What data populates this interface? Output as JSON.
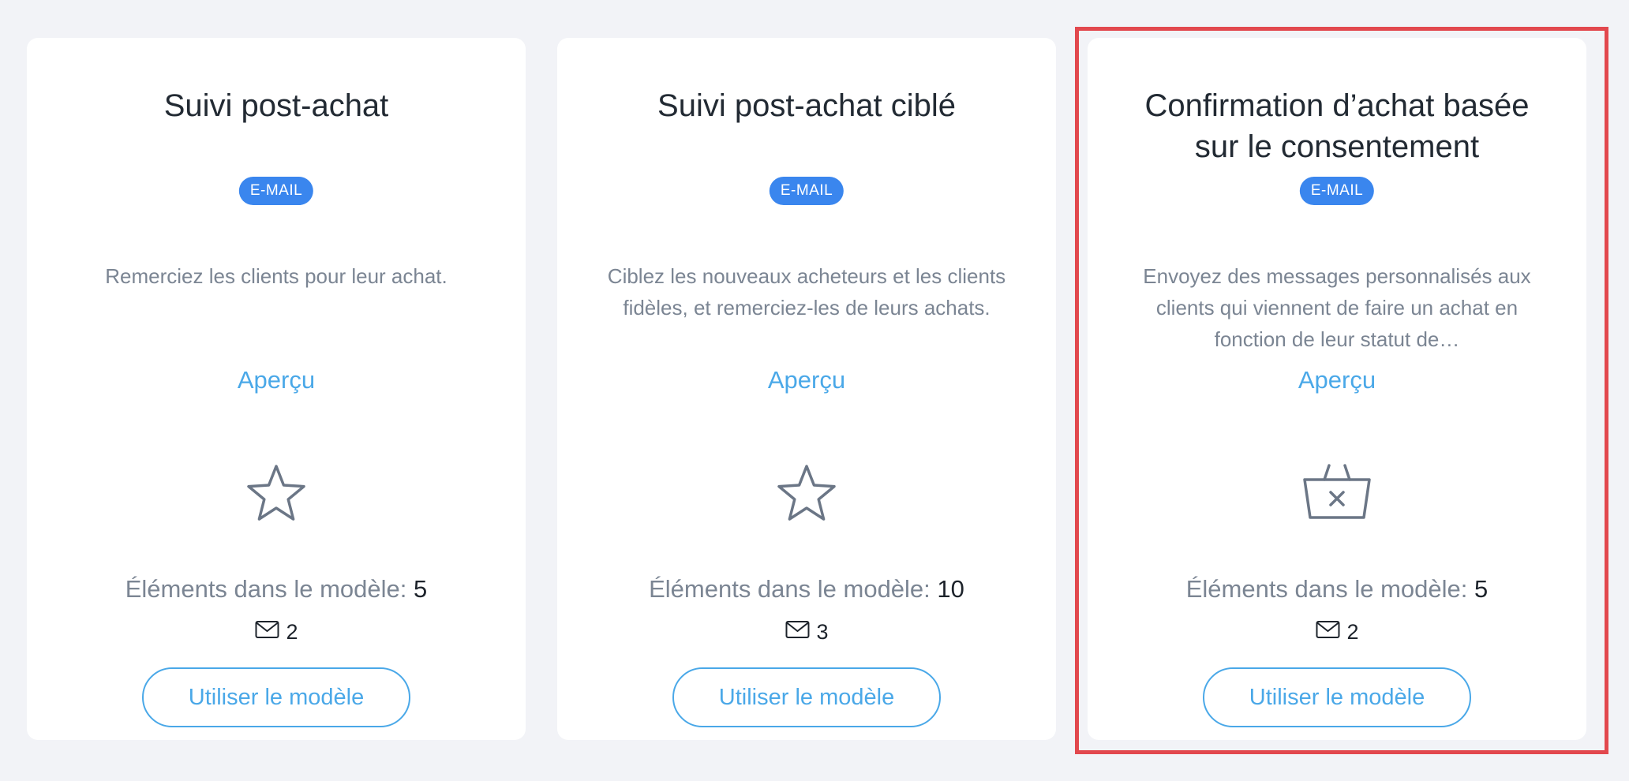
{
  "templates": [
    {
      "title": "Suivi post-achat",
      "badge": "E-MAIL",
      "description": "Remerciez les clients pour leur achat.",
      "preview_label": "Aperçu",
      "icon": "star-icon",
      "elements_label": "Éléments dans le modèle:",
      "elements_count": "5",
      "email_count": "2",
      "button_label": "Utiliser le modèle"
    },
    {
      "title": "Suivi post-achat ciblé",
      "badge": "E-MAIL",
      "description": "Ciblez les nouveaux acheteurs et les clients fidèles, et remerciez-les de leurs achats.",
      "preview_label": "Aperçu",
      "icon": "star-icon",
      "elements_label": "Éléments dans le modèle:",
      "elements_count": "10",
      "email_count": "3",
      "button_label": "Utiliser le modèle"
    },
    {
      "title": "Confirmation d’achat basée sur le consentement",
      "badge": "E-MAIL",
      "description": "Envoyez des messages personnalisés aux clients qui viennent de faire un achat en fonction de leur statut de…",
      "preview_label": "Aperçu",
      "icon": "basket-x-icon",
      "elements_label": "Éléments dans le modèle:",
      "elements_count": "5",
      "email_count": "2",
      "button_label": "Utiliser le modèle"
    }
  ],
  "colors": {
    "background": "#f2f3f7",
    "card": "#ffffff",
    "badge": "#3a86ee",
    "link": "#4aa8e8",
    "muted_text": "#7b8593",
    "icon_stroke": "#6b7686",
    "highlight": "#e2484e"
  }
}
